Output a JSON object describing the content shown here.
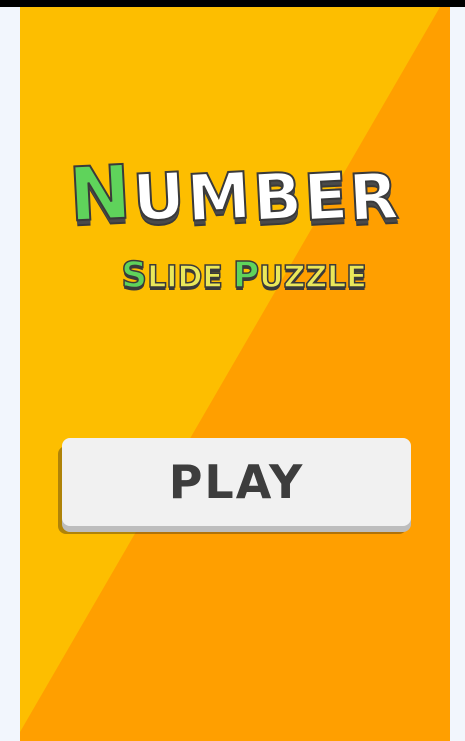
{
  "title": {
    "line1_first_letter": "N",
    "line1_rest": [
      "U",
      "M",
      "B",
      "E",
      "R"
    ],
    "line2_word1_first": "S",
    "line2_word1_rest": "LIDE",
    "line2_word2_first": "P",
    "line2_word2_rest": "UZZLE"
  },
  "play_button": {
    "label": "PLAY"
  },
  "colors": {
    "bg_light": "#fdbe00",
    "bg_dark": "#ff9f00",
    "title_white": "#ffffff",
    "title_green": "#5fd35b",
    "subtitle_yellow": "#eae85a",
    "button_bg": "#f1f1f1",
    "button_text": "#3d3d3d",
    "side_strip": "#f2f6fd"
  }
}
